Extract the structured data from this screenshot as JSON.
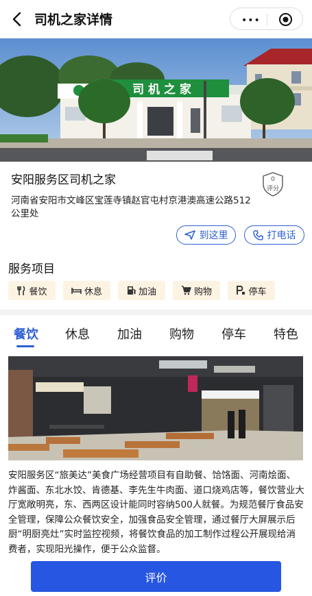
{
  "nav": {
    "title": "司机之家详情",
    "more_label": "•••"
  },
  "hero": {
    "sign_text": "司 机 之 家"
  },
  "station": {
    "name": "安阳服务区司机之家",
    "score_value": "0",
    "score_label": "评分",
    "address": "河南省安阳市文峰区宝莲寺镇赵官屯村京港澳高速公路512公里处",
    "go_label": "到这里",
    "call_label": "打电话"
  },
  "services": {
    "title": "服务项目",
    "chips": [
      {
        "label": "餐饮",
        "icon": "fork-knife-icon"
      },
      {
        "label": "休息",
        "icon": "bed-icon"
      },
      {
        "label": "加油",
        "icon": "fuel-icon"
      },
      {
        "label": "购物",
        "icon": "cart-icon"
      },
      {
        "label": "停车",
        "icon": "parking-icon"
      }
    ]
  },
  "tabs": [
    "餐饮",
    "休息",
    "加油",
    "购物",
    "停车",
    "特色"
  ],
  "active_tab": "餐饮",
  "dining": {
    "description": "安阳服务区“旅美达”美食广场经营项目有自助餐、饸饹面、河南烩面、炸酱面、东北水饺、肯德基、李先生牛肉面、道口烧鸡店等，餐饮营业大厅宽敞明亮，东、西两区设计能同时容纳500人就餐。为规范餐厅食品安全管理，保障公众餐饮安全，加强食品安全管理，通过餐厅大屏展示后厨“明厨亮灶”实时监控视频，将餐饮食品的加工制作过程公开展现给消费者，实现阳光操作，便于公众监督。"
  },
  "footer": {
    "rate_label": "评价"
  },
  "colors": {
    "accent": "#2f5fd6",
    "button": "#2756e2",
    "chip_bg": "#fdf3e3",
    "chip_icon": "#c98a1a"
  }
}
